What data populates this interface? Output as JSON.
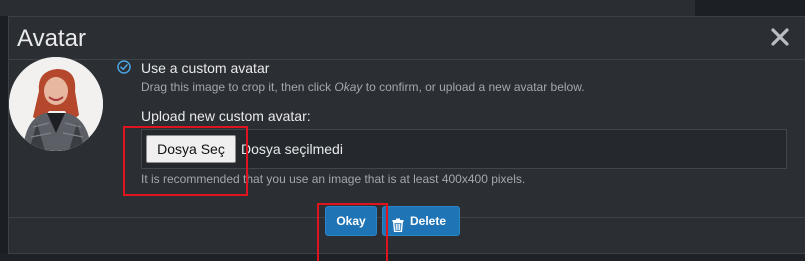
{
  "modal": {
    "title": "Avatar"
  },
  "custom_avatar": {
    "option_label": "Use a custom avatar",
    "hint_before": "Drag this image to crop it, then click ",
    "hint_em": "Okay",
    "hint_after": " to confirm, or upload a new avatar below.",
    "upload_label": "Upload new custom avatar:",
    "file_button_label": "Dosya Seç",
    "file_status": "Dosya seçilmedi",
    "recommendation": "It is recommended that you use an image that is at least 400x400 pixels."
  },
  "footer": {
    "okay_label": "Okay",
    "delete_label": "Delete"
  },
  "icons": {
    "close": "close-icon",
    "radio": "check-circle-icon",
    "delete": "trash-icon"
  },
  "colors": {
    "accent": "#1f74b5",
    "highlight": "#e0141e",
    "panel": "#2b2e33"
  }
}
